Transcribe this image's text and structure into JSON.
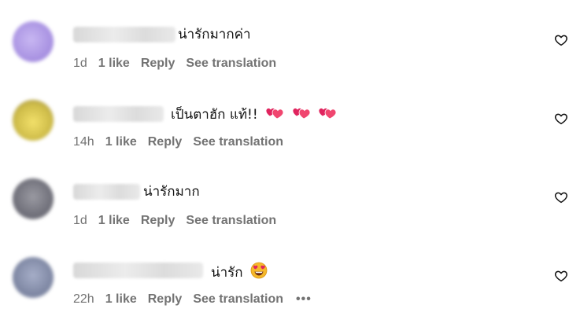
{
  "comments": [
    {
      "text": "น่ารักมากค่า",
      "time": "1d",
      "likes": "1 like",
      "reply": "Reply",
      "translate": "See translation",
      "emojis": [],
      "avatar_color": "#b9a6e8"
    },
    {
      "text": "เป็นตาฮัก แท้!!",
      "time": "14h",
      "likes": "1 like",
      "reply": "Reply",
      "translate": "See translation",
      "emojis": [
        "two-hearts",
        "two-hearts",
        "two-hearts"
      ],
      "avatar_color": "#d9c95a"
    },
    {
      "text": "น่ารักมาก",
      "time": "1d",
      "likes": "1 like",
      "reply": "Reply",
      "translate": "See translation",
      "emojis": [],
      "avatar_color": "#7f7f88"
    },
    {
      "text": "น่ารัก",
      "time": "22h",
      "likes": "1 like",
      "reply": "Reply",
      "translate": "See translation",
      "emojis": [
        "heart-eyes"
      ],
      "avatar_color": "#8a93b0",
      "more": "•••"
    }
  ],
  "icons": {
    "like": "heart-outline-icon"
  },
  "colors": {
    "meta_text": "#737373",
    "text": "#111111",
    "heart_emoji": "#e0245e"
  }
}
